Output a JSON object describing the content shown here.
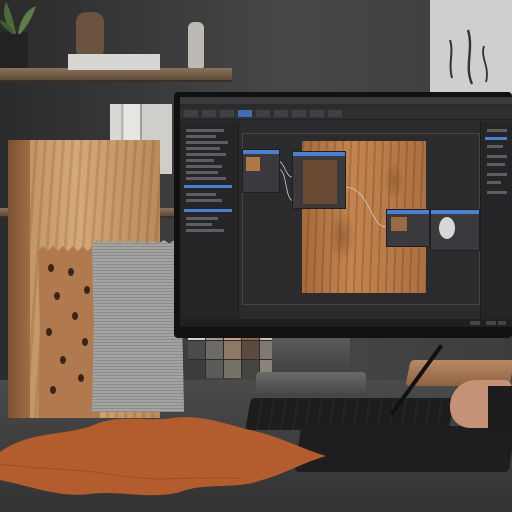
{
  "scene": {
    "colors": {
      "wood_light": "#d3a675",
      "wood_dark": "#7a5232",
      "leather_tan": "#b07a4e",
      "leather_hide": "#b35c2e",
      "fabric_grey": "#9a9a98",
      "ui_accent_blue": "#4d7fca",
      "ui_panel_dark": "#252527"
    },
    "swatch_colors": [
      "#d9d4c8",
      "#a79a8a",
      "#c6a27f",
      "#8b6a50",
      "#d1bfa6",
      "#b99574",
      "#cfa680",
      "#c89a70",
      "#d7b38c",
      "#4a4b4b",
      "#6c6b66",
      "#8c7a66",
      "#5d4a3c",
      "#7e7a71",
      "#a38366",
      "#b1a08c",
      "#8e7c6a",
      "#6b5a4c",
      "#3b3c3c",
      "#5a5b58",
      "#757367",
      "#454440",
      "#8a8376",
      "#9c8f7f",
      "#c9bda8",
      "#b3a48f",
      "#8d8173"
    ],
    "icons": [
      "plant-icon",
      "vase-icon",
      "figurine-icon",
      "monitor-icon",
      "keyboard-icon",
      "tablet-icon",
      "stylus-icon"
    ]
  }
}
